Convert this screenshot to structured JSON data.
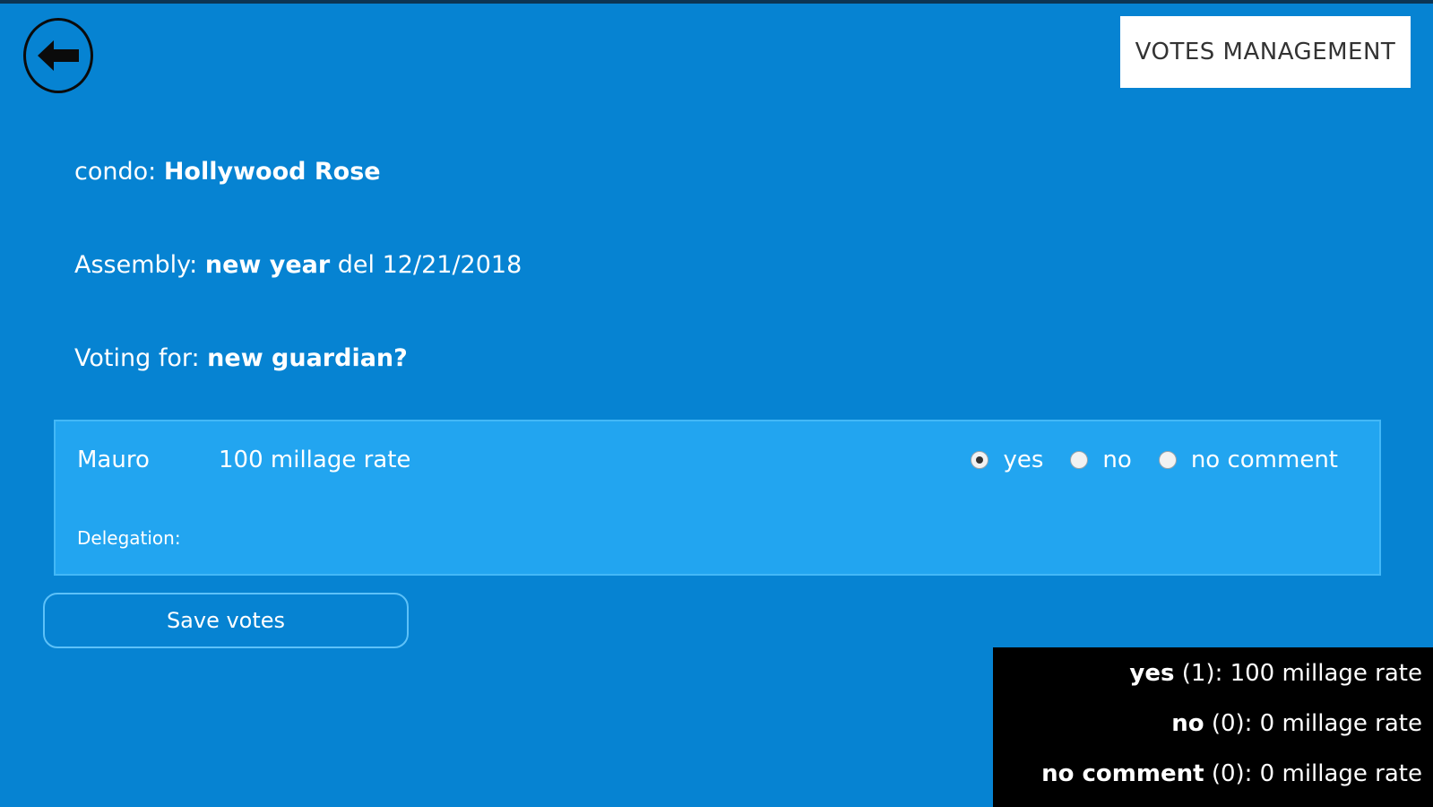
{
  "header": {
    "back_icon": "arrow-left-icon",
    "management_button": "VOTES MANAGEMENT"
  },
  "info": {
    "condo_label": "condo:",
    "condo_value": "Hollywood Rose",
    "assembly_label": "Assembly:",
    "assembly_value": "new year",
    "assembly_suffix": "del 12/21/2018",
    "voting_label": "Voting for:",
    "voting_value": "new guardian?"
  },
  "vote_row": {
    "name": "Mauro",
    "rate": "100 millage rate",
    "delegation_label": "Delegation:",
    "options": [
      {
        "label": "yes",
        "checked": true
      },
      {
        "label": "no",
        "checked": false
      },
      {
        "label": "no comment",
        "checked": false
      }
    ]
  },
  "save_button": "Save votes",
  "summary": {
    "yes_label": "yes",
    "yes_detail": "(1): 100 millage rate",
    "no_label": "no",
    "no_detail": "(0): 0 millage rate",
    "nc_label": "no comment",
    "nc_detail": "(0): 0 millage rate"
  },
  "colors": {
    "background": "#0683d2",
    "row_background": "#22a5f0",
    "summary_background": "#000000"
  }
}
